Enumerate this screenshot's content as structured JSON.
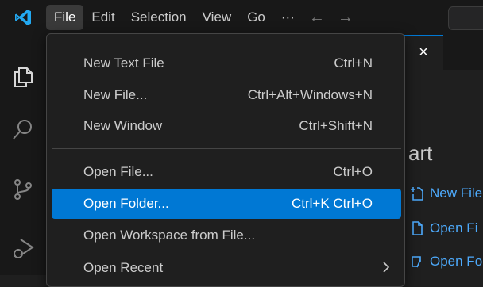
{
  "menubar": {
    "items": [
      {
        "label": "File",
        "active": true
      },
      {
        "label": "Edit"
      },
      {
        "label": "Selection"
      },
      {
        "label": "View"
      },
      {
        "label": "Go"
      },
      {
        "label": "···"
      }
    ],
    "back_arrow": "←",
    "forward_arrow": "→"
  },
  "activitybar": {
    "icons": [
      "explorer-icon",
      "search-icon",
      "source-control-icon",
      "run-debug-icon"
    ]
  },
  "editor": {
    "tab_close": "×",
    "welcome_heading": "art",
    "links": [
      {
        "label": "New File",
        "icon": "new-file-icon"
      },
      {
        "label": "Open Fi",
        "icon": "open-file-icon"
      },
      {
        "label": "Open Fo",
        "icon": "open-folder-icon"
      }
    ]
  },
  "file_menu": {
    "items": [
      {
        "label": "New Text File",
        "shortcut": "Ctrl+N"
      },
      {
        "label": "New File...",
        "shortcut": "Ctrl+Alt+Windows+N"
      },
      {
        "label": "New Window",
        "shortcut": "Ctrl+Shift+N"
      },
      {
        "label": "Open File...",
        "shortcut": "Ctrl+O"
      },
      {
        "label": "Open Folder...",
        "shortcut": "Ctrl+K Ctrl+O",
        "highlighted": true
      },
      {
        "label": "Open Workspace from File...",
        "shortcut": ""
      },
      {
        "label": "Open Recent",
        "shortcut": "",
        "submenu": true
      }
    ]
  },
  "colors": {
    "accent": "#0078d4",
    "link": "#4daafc",
    "logo": "#23a9f2"
  }
}
